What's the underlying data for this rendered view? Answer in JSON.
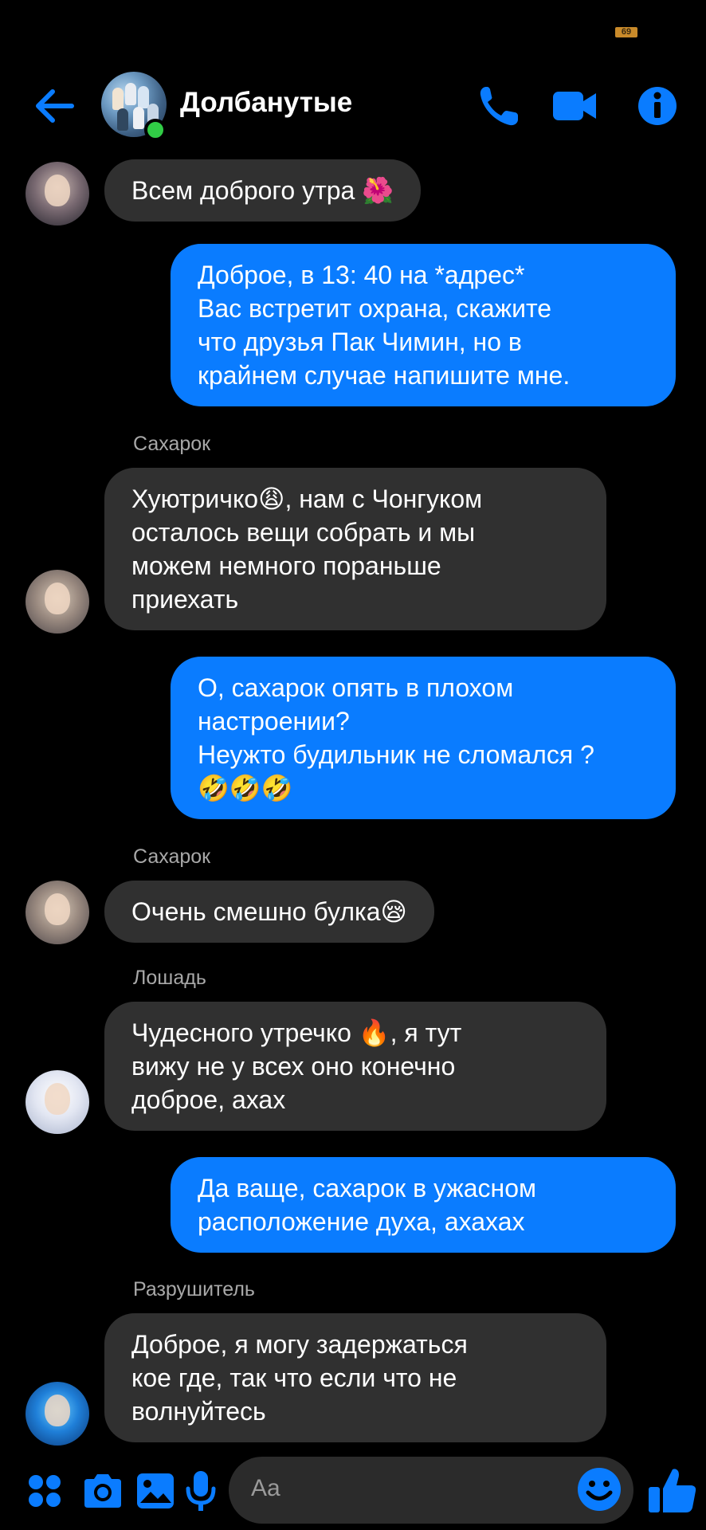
{
  "status_bar": {
    "battery": "69"
  },
  "header": {
    "title": "Долбанутые"
  },
  "colors": {
    "accent": "#0a7cff",
    "incoming_bubble": "#303030",
    "background": "#000000",
    "online": "#31cc46",
    "sender_name": "#a8a8a8"
  },
  "messages": [
    {
      "direction": "in",
      "sender": "",
      "text": "Всем доброго утра 🌺"
    },
    {
      "direction": "out",
      "text": "Доброе, в 13: 40 на *адрес*\nВас встретит охрана, скажите\nчто друзья Пак Чимин, но в\nкрайнем случае напишите мне."
    },
    {
      "direction": "in",
      "sender": "Сахарок",
      "text": "Хуютричко😩, нам с Чонгуком\nосталось вещи собрать и мы\nможем немного пораньше\nприехать"
    },
    {
      "direction": "out",
      "text": "О, сахарок опять в плохом\nнастроении?\nНеужто будильник не сломался ?\n🤣🤣🤣"
    },
    {
      "direction": "in",
      "sender": "Сахарок",
      "text": "Очень смешно булка😪"
    },
    {
      "direction": "in",
      "sender": "Лошадь",
      "text": "Чудесного утречко 🔥, я тут\nвижу не у всех оно конечно\nдоброе, ахах"
    },
    {
      "direction": "out",
      "text": "Да ваще, сахарок в ужасном\nрасположение духа, ахахах"
    },
    {
      "direction": "in",
      "sender": "Разрушитель",
      "text": "Доброе, я могу задержаться\nкое где, так что если что не\nволнуйтесь"
    }
  ],
  "composer": {
    "placeholder": "Aa",
    "icons": [
      "apps-icon",
      "camera-icon",
      "gallery-icon",
      "microphone-icon",
      "emoji-icon",
      "thumbs-up-icon"
    ]
  }
}
